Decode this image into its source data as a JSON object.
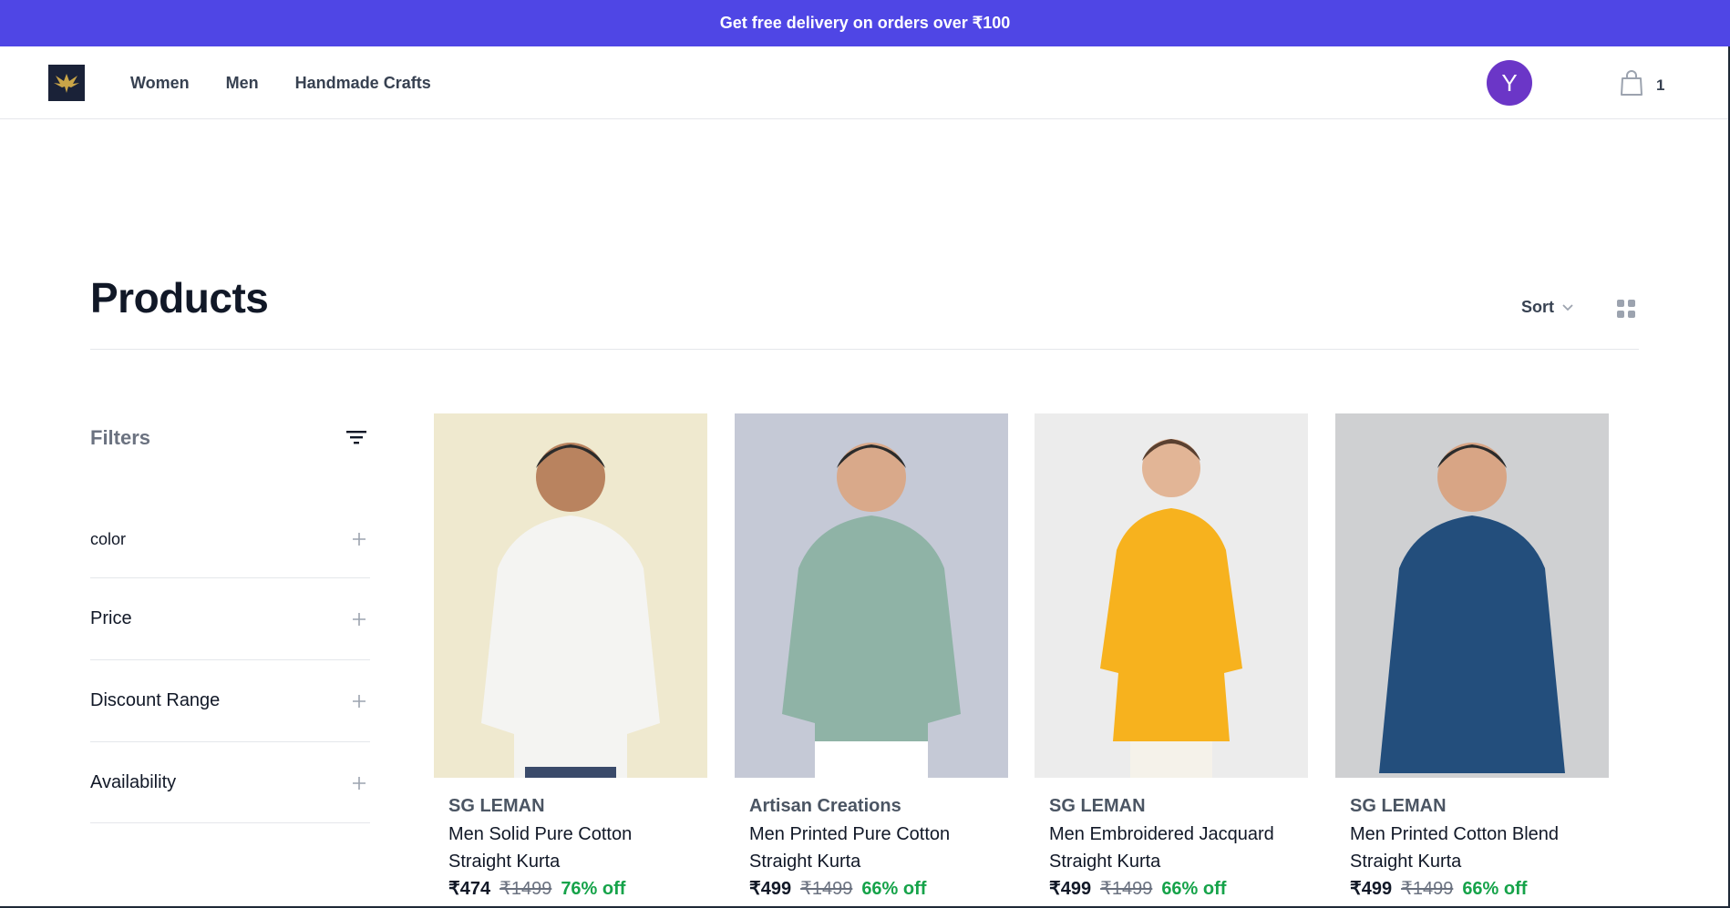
{
  "banner": {
    "text": "Get free delivery on orders over ₹100"
  },
  "header": {
    "logo_icon": "phoenix-logo-icon",
    "nav": [
      "Women",
      "Men",
      "Handmade Crafts"
    ],
    "avatar_initial": "Y",
    "cart_icon": "shopping-bag-icon",
    "cart_count": "1"
  },
  "page": {
    "title": "Products",
    "sort_label": "Sort",
    "sort_icon": "chevron-down-icon",
    "grid_icon": "grid-view-icon"
  },
  "filters": {
    "title": "Filters",
    "title_icon": "filter-lines-icon",
    "sections": [
      "color",
      "Price",
      "Discount Range",
      "Availability"
    ]
  },
  "products": [
    {
      "brand": "SG LEMAN",
      "name": "Men Solid Pure Cotton Straight Kurta",
      "price": "₹474",
      "mrp": "₹1499",
      "discount": "76% off",
      "image_bg": "#efe9cf",
      "shirt_color": "#f4f4f2"
    },
    {
      "brand": "Artisan Creations",
      "name": "Men Printed Pure Cotton Straight Kurta",
      "price": "₹499",
      "mrp": "₹1499",
      "discount": "66% off",
      "image_bg": "#c5c9d6",
      "shirt_color": "#8fb3a6"
    },
    {
      "brand": "SG LEMAN",
      "name": "Men Embroidered Jacquard Straight Kurta",
      "price": "₹499",
      "mrp": "₹1499",
      "discount": "66% off",
      "image_bg": "#ececec",
      "shirt_color": "#f7b21e"
    },
    {
      "brand": "SG LEMAN",
      "name": "Men Printed Cotton Blend Straight Kurta",
      "price": "₹499",
      "mrp": "₹1499",
      "discount": "66% off",
      "image_bg": "#cfd0d2",
      "shirt_color": "#234e7c"
    }
  ]
}
